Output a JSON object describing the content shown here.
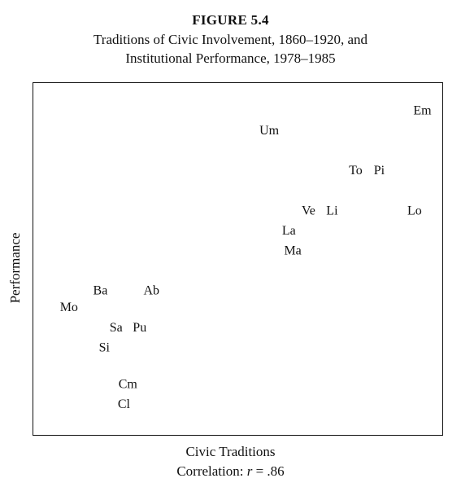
{
  "figure_number": "FIGURE 5.4",
  "title_line1": "Traditions of Civic Involvement, 1860–1920, and",
  "title_line2": "Institutional Performance, 1978–1985",
  "correlation": {
    "prefix": "Correlation: ",
    "variable": "r",
    "suffix": " = .86"
  },
  "chart_data": {
    "type": "scatter",
    "title": "Traditions of Civic Involvement, 1860–1920, and Institutional Performance, 1978–1985",
    "xlabel": "Civic Traditions",
    "ylabel": "Performance",
    "xlim": [
      0,
      100
    ],
    "ylim": [
      0,
      100
    ],
    "x_ticks_shown": false,
    "y_ticks_shown": false,
    "grid": false,
    "legend": "none",
    "annotation": "Correlation: r = .86",
    "points": [
      {
        "label": "Em",
        "x": 97,
        "y": 94
      },
      {
        "label": "Um",
        "x": 58,
        "y": 88
      },
      {
        "label": "To",
        "x": 80,
        "y": 76
      },
      {
        "label": "Pi",
        "x": 86,
        "y": 76
      },
      {
        "label": "Ve",
        "x": 68,
        "y": 64
      },
      {
        "label": "Li",
        "x": 74,
        "y": 64
      },
      {
        "label": "Lo",
        "x": 95,
        "y": 64
      },
      {
        "label": "La",
        "x": 63,
        "y": 58
      },
      {
        "label": "Ma",
        "x": 64,
        "y": 52
      },
      {
        "label": "Ba",
        "x": 15,
        "y": 40
      },
      {
        "label": "Ab",
        "x": 28,
        "y": 40
      },
      {
        "label": "Mo",
        "x": 7,
        "y": 35
      },
      {
        "label": "Sa",
        "x": 19,
        "y": 29
      },
      {
        "label": "Pu",
        "x": 25,
        "y": 29
      },
      {
        "label": "Si",
        "x": 16,
        "y": 23
      },
      {
        "label": "Cm",
        "x": 22,
        "y": 12
      },
      {
        "label": "Cl",
        "x": 21,
        "y": 6
      }
    ]
  }
}
